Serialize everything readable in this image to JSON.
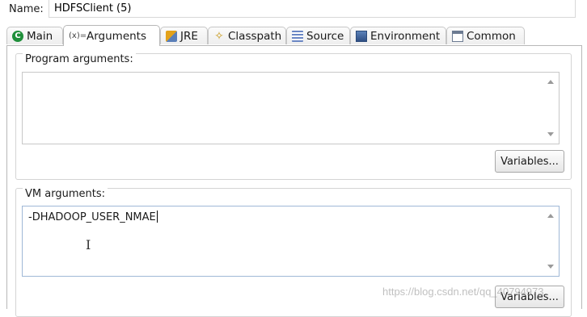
{
  "config": {
    "name_label": "Name:",
    "name_value": "HDFSClient (5)"
  },
  "tabs": [
    {
      "label": "Main",
      "icon": "main-class-icon"
    },
    {
      "label": "Arguments",
      "icon": "arguments-icon",
      "icon_text": "(x)="
    },
    {
      "label": "JRE",
      "icon": "jre-icon"
    },
    {
      "label": "Classpath",
      "icon": "classpath-icon"
    },
    {
      "label": "Source",
      "icon": "source-icon"
    },
    {
      "label": "Environment",
      "icon": "environment-icon"
    },
    {
      "label": "Common",
      "icon": "common-icon"
    }
  ],
  "active_tab": "Arguments",
  "program_args": {
    "title": "Program arguments:",
    "value": "",
    "variables_label": "Variables..."
  },
  "vm_args": {
    "title": "VM arguments:",
    "value": "-DHADOOP_USER_NMAE",
    "variables_label": "Variables..."
  },
  "watermark": "https://blog.csdn.net/qq_40794973"
}
